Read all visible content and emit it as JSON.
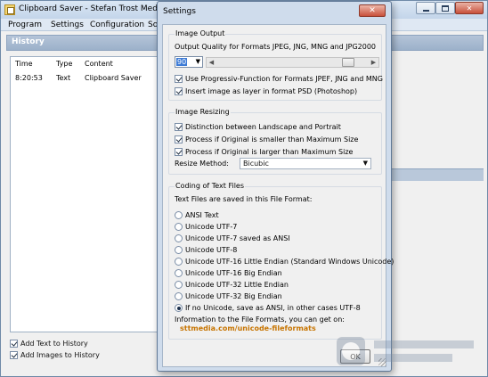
{
  "main_window": {
    "title": "Clipboard Saver - Stefan Trost Media",
    "menu": [
      "Program",
      "Settings",
      "Configuration",
      "So"
    ],
    "history": {
      "title": "History",
      "columns": [
        "Time",
        "Type",
        "Content"
      ],
      "rows": [
        {
          "time": "8:20:53",
          "type": "Text",
          "content": "Clipboard Saver"
        }
      ]
    },
    "checkboxes": [
      {
        "label": "Add Text to History",
        "checked": true
      },
      {
        "label": "Add Images to History",
        "checked": true
      }
    ]
  },
  "settings": {
    "title": "Settings",
    "close_glyph": "✕",
    "image_output": {
      "title": "Image Output",
      "quality_label": "Output Quality for Formats JPEG, JNG, MNG and JPG2000",
      "quality_value": "90",
      "quality_fraction": 0.9,
      "options": [
        {
          "label": "Use Progressiv-Function for Formats JPEF, JNG and MNG",
          "checked": true
        },
        {
          "label": "Insert image as layer in format PSD (Photoshop)",
          "checked": true
        }
      ]
    },
    "image_resizing": {
      "title": "Image Resizing",
      "options": [
        {
          "label": "Distinction between Landscape and Portrait",
          "checked": true
        },
        {
          "label": "Process if Original is smaller than Maximum Size",
          "checked": true
        },
        {
          "label": "Process if Original is larger than Maximum Size",
          "checked": true
        }
      ],
      "method_label": "Resize Method:",
      "method_value": "Bicubic"
    },
    "text_files": {
      "title": "Coding of Text Files",
      "intro": "Text Files are saved in this File Format:",
      "formats": [
        {
          "label": "ANSI Text",
          "selected": false
        },
        {
          "label": "Unicode UTF-7",
          "selected": false
        },
        {
          "label": "Unicode UTF-7 saved as ANSI",
          "selected": false
        },
        {
          "label": "Unicode UTF-8",
          "selected": false
        },
        {
          "label": "Unicode UTF-16 Little Endian (Standard Windows Unicode)",
          "selected": false
        },
        {
          "label": "Unicode UTF-16 Big Endian",
          "selected": false
        },
        {
          "label": "Unicode UTF-32 Little Endian",
          "selected": false
        },
        {
          "label": "Unicode UTF-32 Big Endian",
          "selected": false
        },
        {
          "label": "If no Unicode, save as ANSI, in other cases UTF-8",
          "selected": true
        }
      ],
      "info": "Information to the File Formats, you can get on:",
      "link": "sttmedia.com/unicode-fileformats"
    },
    "ok_label": "OK"
  }
}
